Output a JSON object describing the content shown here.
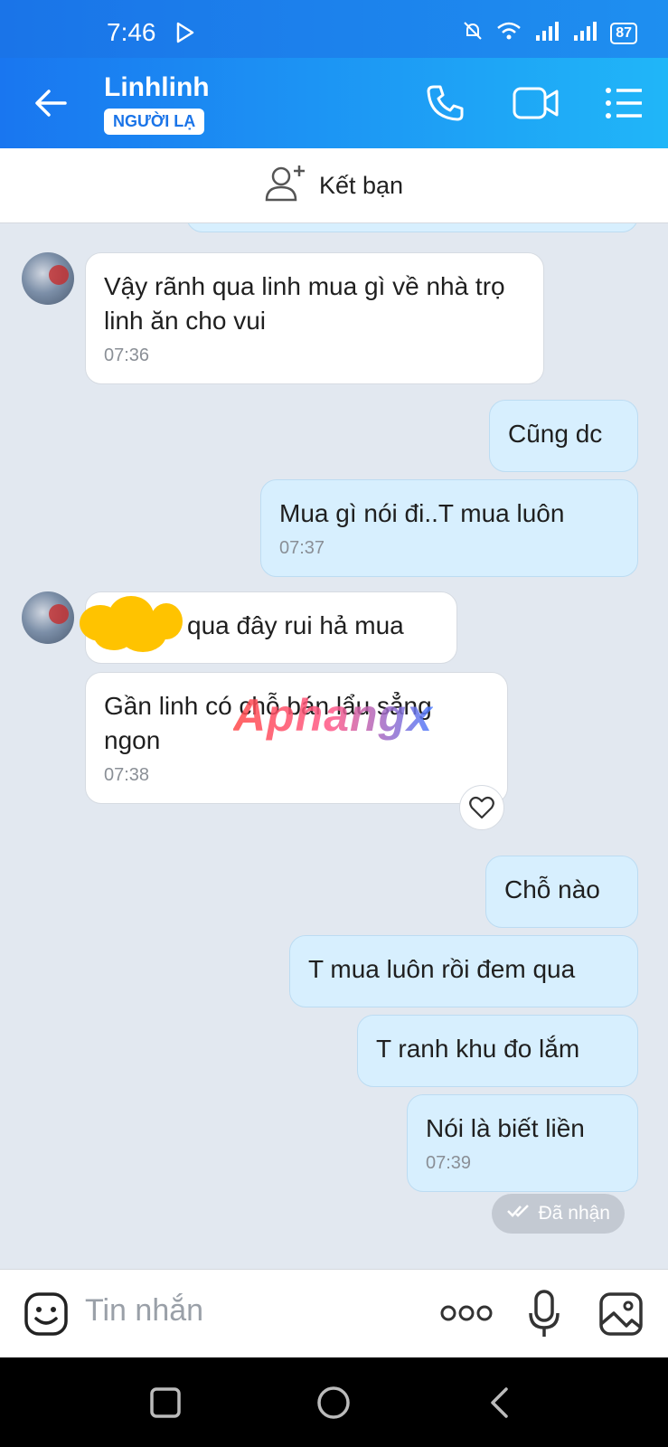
{
  "status_bar": {
    "time": "7:46",
    "battery": "87"
  },
  "header": {
    "contact_name": "Linhlinh",
    "badge": "NGƯỜI LẠ"
  },
  "friend_bar": {
    "label": "Kết bạn"
  },
  "messages": [
    {
      "side": "in",
      "text": "Vậy rãnh qua linh mua gì về nhà trọ linh ăn cho vui",
      "time": "07:36"
    },
    {
      "side": "out",
      "text": "Cũng dc"
    },
    {
      "side": "out",
      "text": "Mua gì nói đi..T mua luôn",
      "time": "07:37"
    },
    {
      "side": "in",
      "text": "qua đây rui hả mua"
    },
    {
      "side": "in",
      "text": "Gần linh có chỗ bán lẩu sẳng ngon",
      "time": "07:38"
    },
    {
      "side": "out",
      "text": "Chỗ nào"
    },
    {
      "side": "out",
      "text": "T mua luôn rồi đem qua"
    },
    {
      "side": "out",
      "text": "T ranh khu đo lắm"
    },
    {
      "side": "out",
      "text": "Nói là biết liền",
      "time": "07:39"
    }
  ],
  "received_status": "Đã nhận",
  "watermark": "Aphangx",
  "input": {
    "placeholder": "Tin nhắn"
  },
  "icons": [
    "back-arrow-icon",
    "phone-icon",
    "video-call-icon",
    "menu-list-icon",
    "add-friend-icon",
    "emoji-icon",
    "more-icon",
    "microphone-icon",
    "image-icon",
    "heart-icon"
  ],
  "colors": {
    "header_start": "#1976f0",
    "header_end": "#20b6f8",
    "outgoing_bubble": "#d7effe",
    "incoming_bubble": "#ffffff",
    "chat_bg": "#e2e8f0"
  }
}
